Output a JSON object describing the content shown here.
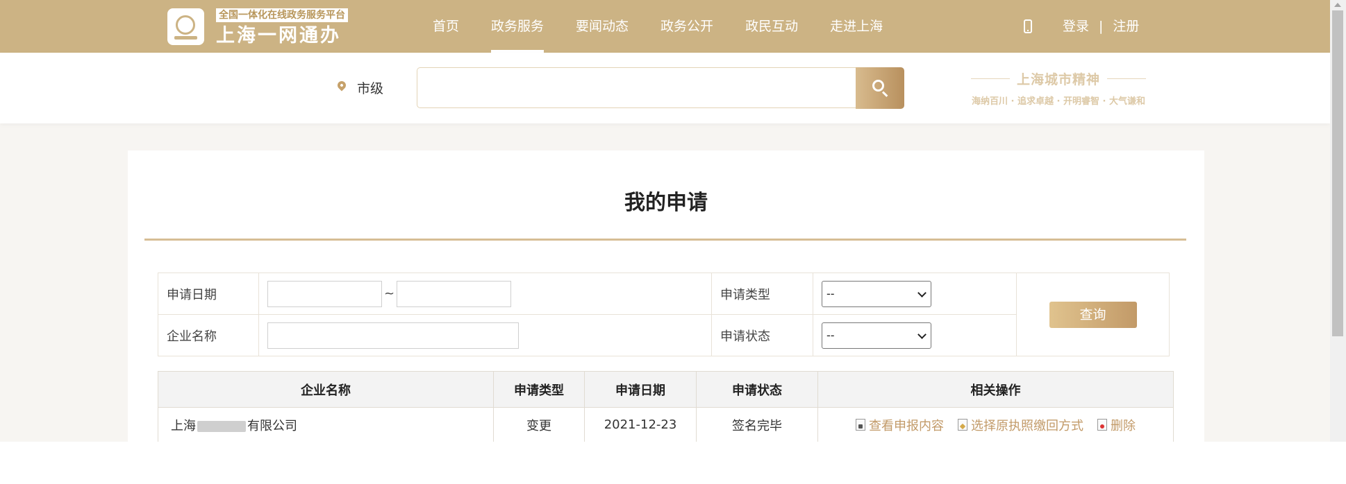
{
  "header": {
    "logo_tagline": "全国一体化在线政务服务平台",
    "logo_title": "上海一网通办",
    "nav": [
      "首页",
      "政务服务",
      "要闻动态",
      "政务公开",
      "政民互动",
      "走进上海"
    ],
    "active_nav": "政务服务",
    "login": "登录",
    "separator": "|",
    "register": "注册",
    "accent_color": "#ccb384"
  },
  "search": {
    "location": "市级",
    "placeholder": "",
    "spirit_title": "上海城市精神",
    "spirit_subtitle": "海纳百川 · 追求卓越 · 开明睿智 · 大气谦和"
  },
  "main": {
    "title": "我的申请",
    "filter": {
      "date_label": "申请日期",
      "date_sep": "~",
      "type_label": "申请类型",
      "type_value": "--",
      "company_label": "企业名称",
      "status_label": "申请状态",
      "status_value": "--",
      "query_button": "查询"
    },
    "table": {
      "headers": [
        "企业名称",
        "申请类型",
        "申请日期",
        "申请状态",
        "相关操作"
      ],
      "rows": [
        {
          "company_prefix": "上海",
          "company_suffix": "有限公司",
          "type": "变更",
          "date": "2021-12-23",
          "status": "签名完毕",
          "actions": [
            "查看申报内容",
            "选择原执照缴回方式",
            "删除"
          ]
        }
      ]
    }
  }
}
